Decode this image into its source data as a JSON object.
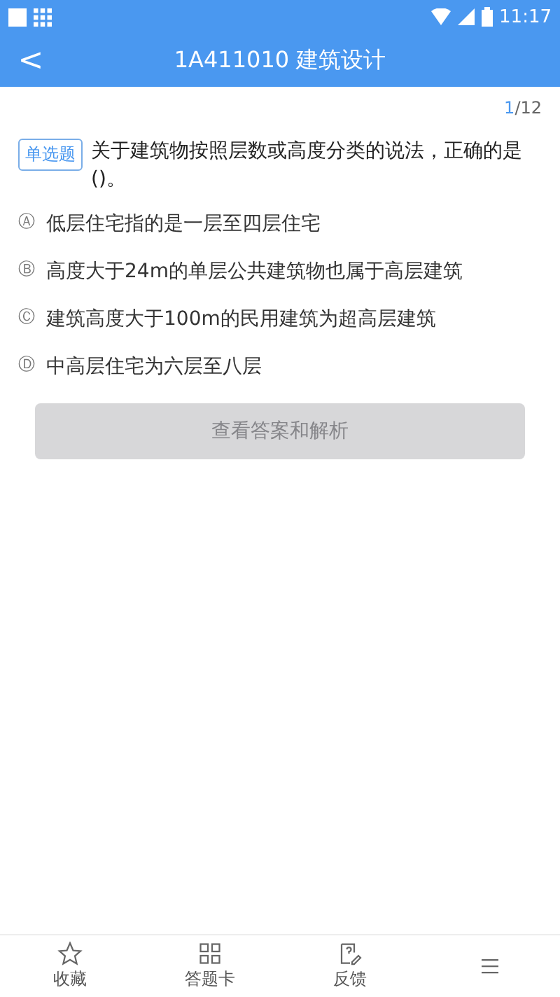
{
  "status_bar": {
    "time": "11:17"
  },
  "header": {
    "back": "<",
    "title": "1A411010  建筑设计"
  },
  "progress": {
    "current": "1",
    "total": "/12"
  },
  "question": {
    "type_tag": "单选题",
    "text": "关于建筑物按照层数或高度分类的说法，正确的是()。"
  },
  "options": [
    {
      "mark": "Ⓐ",
      "text": "低层住宅指的是一层至四层住宅",
      "selected": false
    },
    {
      "mark": "Ⓑ",
      "text": "高度大于24m的单层公共建筑物也属于高层建筑",
      "selected": false
    },
    {
      "mark": "Ⓒ",
      "text": "建筑高度大于100m的民用建筑为超高层建筑",
      "selected": false
    },
    {
      "mark": "Ⓓ",
      "text": "中高层住宅为六层至八层",
      "selected": false
    }
  ],
  "answer_button": {
    "label": "查看答案和解析",
    "disabled": true
  },
  "bottom_nav": [
    {
      "kind": "star",
      "label": "收藏"
    },
    {
      "kind": "grid",
      "label": "答题卡"
    },
    {
      "kind": "feedback",
      "label": "反馈"
    },
    {
      "kind": "more"
    }
  ]
}
